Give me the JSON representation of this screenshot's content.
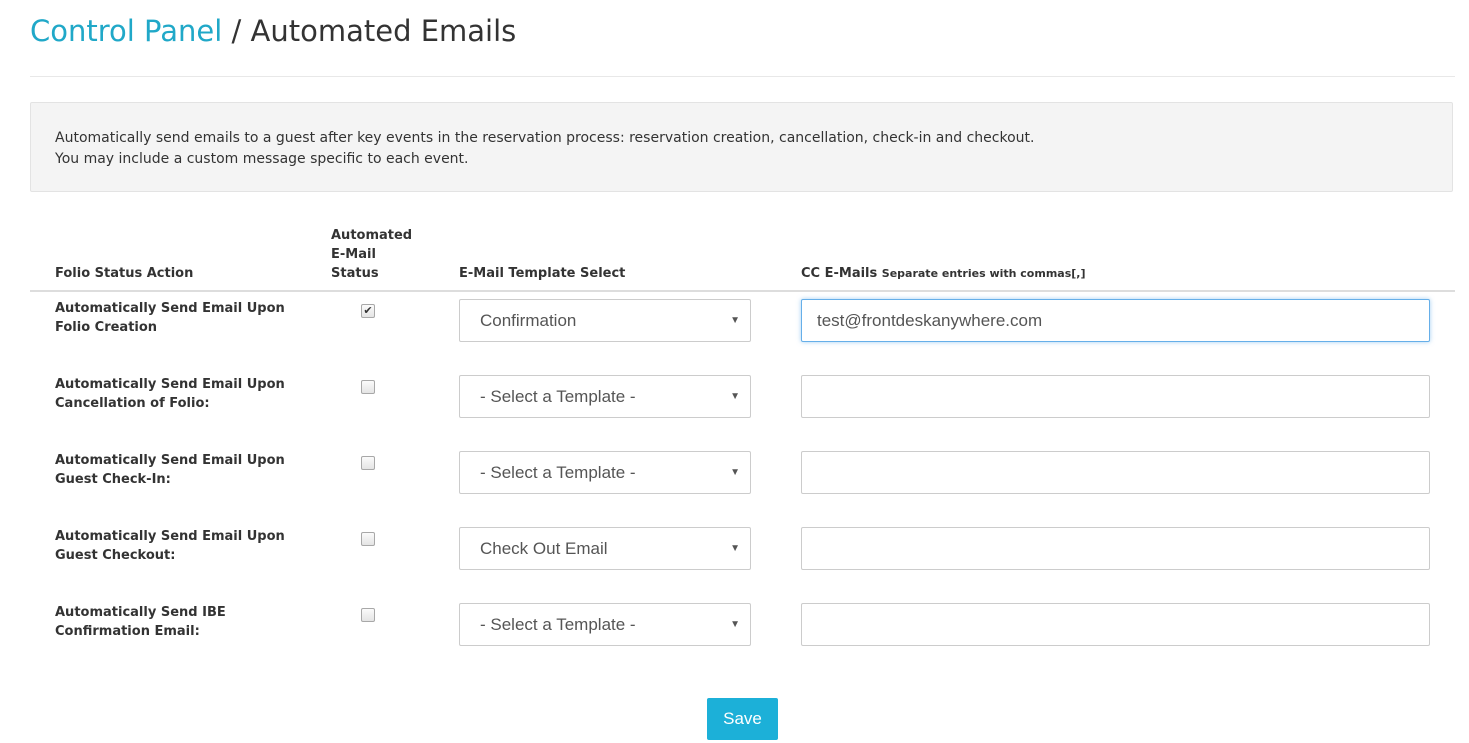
{
  "header": {
    "breadcrumb_link": "Control Panel",
    "separator": " / ",
    "current": "Automated Emails"
  },
  "info": {
    "line1": "Automatically send emails to a guest after key events in the reservation process: reservation creation, cancellation, check-in and checkout.",
    "line2": "You may include a custom message specific to each event."
  },
  "table": {
    "headers": {
      "action": "Folio Status Action",
      "status_line1": "Automated",
      "status_line2": "E-Mail",
      "status_line3": "Status",
      "template": "E-Mail Template Select",
      "cc": "CC E-Mails",
      "cc_hint": "Separate entries with commas[,]"
    },
    "rows": [
      {
        "label_line1": "Automatically Send Email Upon",
        "label_line2": "Folio Creation",
        "checked": true,
        "template": "Confirmation",
        "cc": "test@frontdeskanywhere.com"
      },
      {
        "label_line1": "Automatically Send Email Upon",
        "label_line2": "Cancellation of Folio:",
        "checked": false,
        "template": "- Select a Template -",
        "cc": ""
      },
      {
        "label_line1": "Automatically Send Email Upon",
        "label_line2": "Guest Check-In:",
        "checked": false,
        "template": "- Select a Template -",
        "cc": ""
      },
      {
        "label_line1": "Automatically Send Email Upon",
        "label_line2": "Guest Checkout:",
        "checked": false,
        "template": "Check Out Email",
        "cc": ""
      },
      {
        "label_line1": "Automatically Send IBE",
        "label_line2": "Confirmation Email:",
        "checked": false,
        "template": "- Select a Template -",
        "cc": ""
      }
    ]
  },
  "actions": {
    "save_label": "Save"
  },
  "colors": {
    "link": "#20a8c8",
    "button": "#1cb0d8",
    "focus": "#66afe9"
  }
}
